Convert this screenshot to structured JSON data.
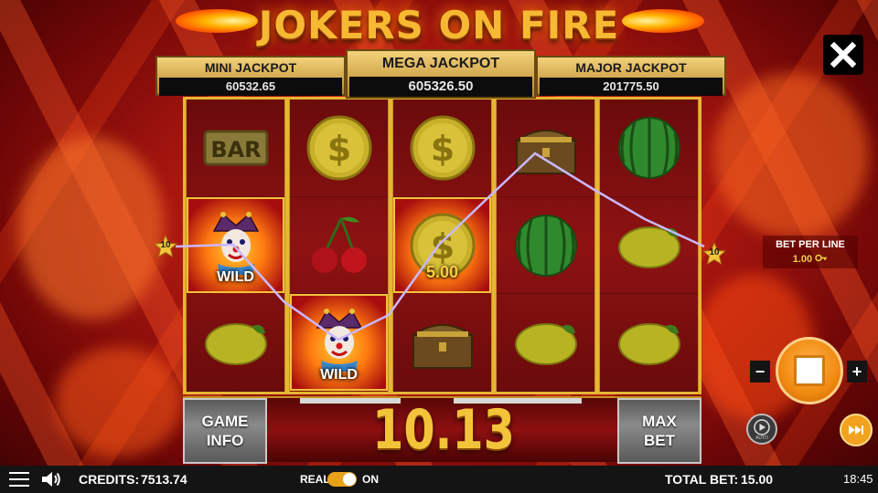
{
  "game": {
    "title": "JOKERS ON FIRE"
  },
  "jackpots": {
    "mini": {
      "label": "MINI JACKPOT",
      "value": "60532.65"
    },
    "mega": {
      "label": "MEGA JACKPOT",
      "value": "605326.50"
    },
    "major": {
      "label": "MAJOR JACKPOT",
      "value": "201775.50"
    }
  },
  "reels": [
    [
      {
        "symbol": "bar",
        "text": "BAR"
      },
      {
        "symbol": "joker-wild",
        "label": "WILD",
        "win": true
      },
      {
        "symbol": "lemon"
      }
    ],
    [
      {
        "symbol": "dollar-coin"
      },
      {
        "symbol": "cherries"
      },
      {
        "symbol": "joker-wild",
        "label": "WILD",
        "win": true
      }
    ],
    [
      {
        "symbol": "dollar-coin"
      },
      {
        "symbol": "dollar-coin",
        "amount": "5.00",
        "win": true
      },
      {
        "symbol": "treasure-chest"
      }
    ],
    [
      {
        "symbol": "treasure-chest"
      },
      {
        "symbol": "watermelon"
      },
      {
        "symbol": "lemon"
      }
    ],
    [
      {
        "symbol": "watermelon"
      },
      {
        "symbol": "lemon"
      },
      {
        "symbol": "lemon"
      }
    ]
  ],
  "payline": {
    "left_number": "10",
    "right_number": "10",
    "color": "#c9b8ff"
  },
  "win": {
    "amount": "10.13"
  },
  "buttons": {
    "game_info_line1": "GAME",
    "game_info_line2": "INFO",
    "max_bet_line1": "MAX",
    "max_bet_line2": "BET",
    "minus": "−",
    "plus": "+",
    "auto": "AUTO"
  },
  "bet_per_line": {
    "label": "BET PER LINE",
    "value": "1.00"
  },
  "status_bar": {
    "credits_label": "CREDITS:",
    "credits_value": "7513.74",
    "real_label": "REAL",
    "on_label": "ON",
    "total_bet_label": "TOTAL BET:",
    "total_bet_value": "15.00",
    "time": "18:45"
  },
  "colors": {
    "accent": "#f08a10",
    "gold": "#e6b634",
    "title": "#f7b832"
  }
}
